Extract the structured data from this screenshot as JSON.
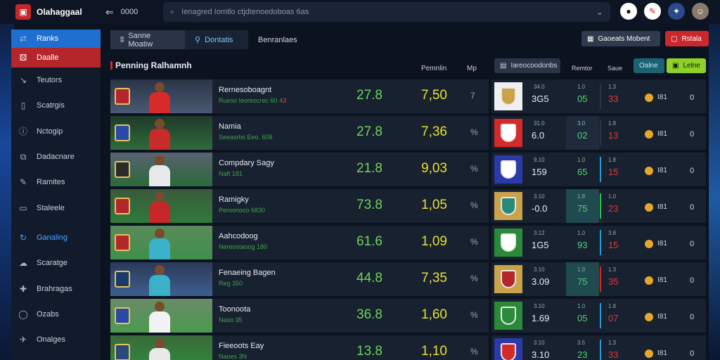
{
  "app": {
    "title": "Olahaggaal",
    "back_label": "0000"
  },
  "search": {
    "placeholder": "Ienagred Iomtlo ctjdtenoedoboas 6as"
  },
  "sidebar": {
    "items": [
      {
        "label": "Ranks",
        "icon": "sync-icon"
      },
      {
        "label": "Daalle",
        "icon": "dice-icon"
      },
      {
        "label": "Teutors",
        "icon": "arrow-icon"
      },
      {
        "label": "Scatrgis",
        "icon": "phone-icon"
      },
      {
        "label": "Nctogip",
        "icon": "info-icon"
      },
      {
        "label": "Dadacnare",
        "icon": "layers-icon"
      },
      {
        "label": "Ramites",
        "icon": "pen-icon"
      },
      {
        "label": "Staleele",
        "icon": "chat-icon"
      },
      {
        "label": "Ganaling",
        "icon": "refresh-icon"
      },
      {
        "label": "Scaratge",
        "icon": "cloud-icon"
      },
      {
        "label": "Brahragas",
        "icon": "plus-icon"
      },
      {
        "label": "Ozabs",
        "icon": "bubble-icon"
      },
      {
        "label": "Onalges",
        "icon": "bird-icon"
      }
    ]
  },
  "tabs": [
    {
      "label": "Sanne Moatiw"
    },
    {
      "label": "Dontatis"
    },
    {
      "label": "Benranlaes"
    }
  ],
  "header_buttons": {
    "market": "Gaoeats Mobent",
    "rank": "Rstala"
  },
  "panel": {
    "title": "Penning Ralhamnh",
    "col1": "Pemnlin",
    "col2": "Mp"
  },
  "rows": [
    {
      "name": "Rernesoboagnt",
      "sub": "Rueso Ieoreocrec 60",
      "sub_red": "43",
      "v1": "27.8",
      "v2": "7,50",
      "v3": "7"
    },
    {
      "name": "Namia",
      "sub": "Seeasrbs Eeo. 608",
      "sub_red": "",
      "v1": "27.8",
      "v2": "7,36",
      "v3": "%"
    },
    {
      "name": "Compdary Sagy",
      "sub": "Naft 181",
      "sub_red": "",
      "v1": "21.8",
      "v2": "9,03",
      "v3": "%"
    },
    {
      "name": "Ramigky",
      "sub": "Peroonoco 6830",
      "sub_red": "",
      "v1": "73.8",
      "v2": "1,05",
      "v3": "%"
    },
    {
      "name": "Aahcodoog",
      "sub": "Nereostaoog 180",
      "sub_red": "",
      "v1": "61.6",
      "v2": "1,09",
      "v3": "%"
    },
    {
      "name": "Fenaeing Bagen",
      "sub": "Reg 350",
      "sub_red": "",
      "v1": "44.8",
      "v2": "7,35",
      "v3": "%"
    },
    {
      "name": "Toonoota",
      "sub": "Naso 35",
      "sub_red": "",
      "v1": "36.8",
      "v2": "1,60",
      "v3": "%"
    },
    {
      "name": "Fieeoots Eay",
      "sub": "Naoes 3N",
      "sub_red": "",
      "v1": "13.8",
      "v2": "1,10",
      "v3": "%"
    }
  ],
  "right_panel": {
    "market_btn": "Iareocoodonbs",
    "col_a": "Remtor",
    "col_b": "Saue",
    "online_btn": "Oalne",
    "live_btn": "Lelne",
    "rows": [
      {
        "small": "34.0",
        "big": "3G5",
        "msmall": "1.0",
        "mval": "05",
        "rsmall": "1.3",
        "rval": "33",
        "stat": "I81",
        "zero": "0"
      },
      {
        "small": "31.0",
        "big": "6.0",
        "msmall": "3.0",
        "mval": "02",
        "rsmall": "1.8",
        "rval": "13",
        "stat": "I81",
        "zero": "0"
      },
      {
        "small": "9.10",
        "big": "159",
        "msmall": "1.0",
        "mval": "65",
        "rsmall": "1.8",
        "rval": "15",
        "stat": "I81",
        "zero": "0"
      },
      {
        "small": "3.10",
        "big": "-0.0",
        "msmall": "1.8",
        "mval": "75",
        "rsmall": "1.0",
        "rval": "23",
        "stat": "I81",
        "zero": "0"
      },
      {
        "small": "3.12",
        "big": "1G5",
        "msmall": "1.0",
        "mval": "93",
        "rsmall": "3.8",
        "rval": "15",
        "stat": "I81",
        "zero": "0"
      },
      {
        "small": "3.10",
        "big": "3.09",
        "msmall": "1.0",
        "mval": "75",
        "rsmall": "1.3",
        "rval": "35",
        "stat": "I81",
        "zero": "0"
      },
      {
        "small": "3.10",
        "big": "1.69",
        "msmall": "1.0",
        "mval": "05",
        "rsmall": "1.8",
        "rval": "07",
        "stat": "I81",
        "zero": "0"
      },
      {
        "small": "3.10",
        "big": "3.10",
        "msmall": "3.5",
        "mval": "23",
        "rsmall": "1.3",
        "rval": "33",
        "stat": "I81",
        "zero": "0"
      }
    ]
  },
  "colors": {
    "accent_blue": "#1e6fd0",
    "accent_red": "#c9282d",
    "green": "#6fd35a",
    "yellow": "#e5e037",
    "live": "#8fd12b"
  }
}
